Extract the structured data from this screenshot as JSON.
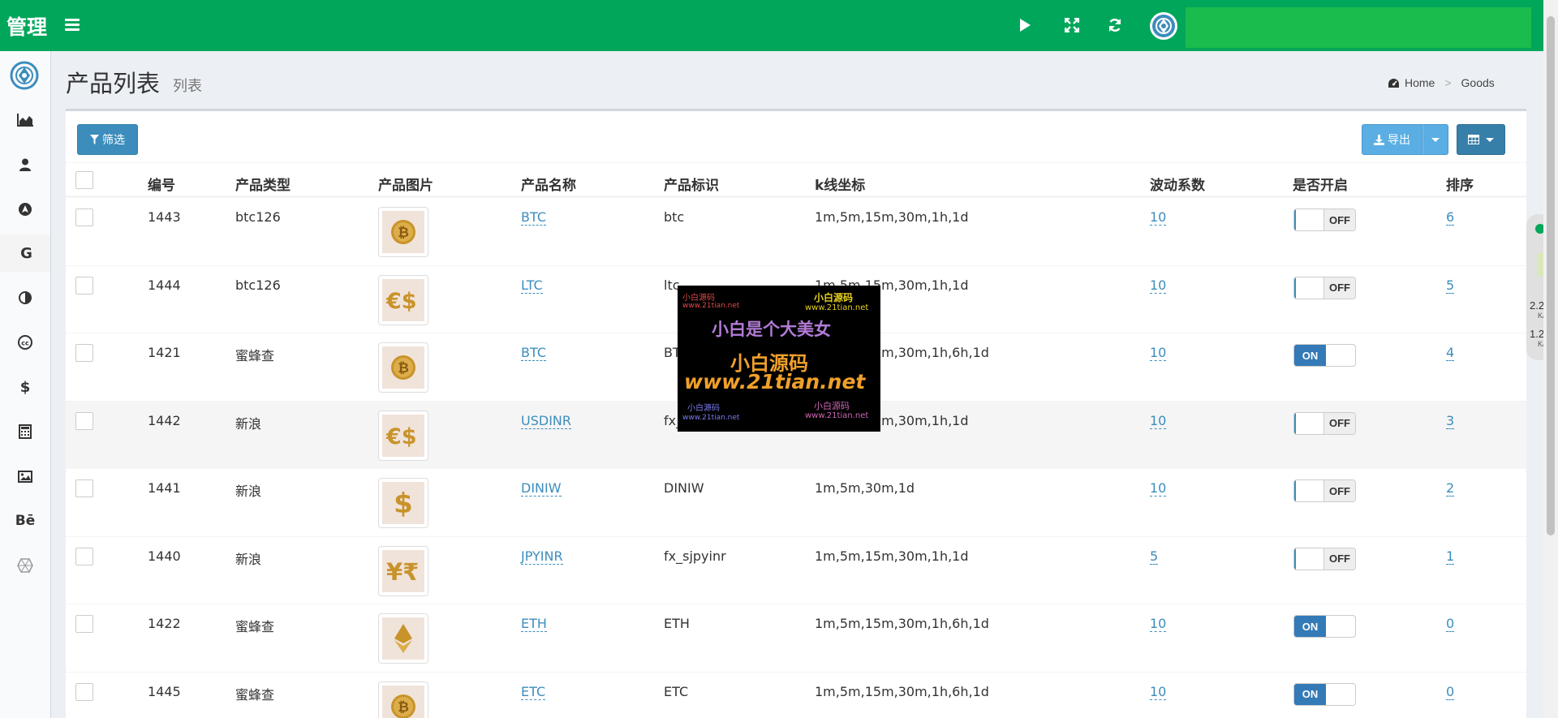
{
  "app": {
    "brand": "管理",
    "accent_color": "#00a65a"
  },
  "topbar": {
    "icons": [
      "menu-icon",
      "play-icon",
      "fullscreen-icon",
      "refresh-icon",
      "avatar-icon"
    ]
  },
  "sidebar": {
    "items": [
      {
        "icon": "area-chart-icon"
      },
      {
        "icon": "user-icon"
      },
      {
        "icon": "navigation-icon"
      },
      {
        "icon": "google-icon",
        "text": "G"
      },
      {
        "icon": "contrast-icon"
      },
      {
        "icon": "creative-commons-icon"
      },
      {
        "icon": "dollar-icon",
        "text": "$"
      },
      {
        "icon": "calculator-icon"
      },
      {
        "icon": "image-icon"
      },
      {
        "icon": "behance-icon",
        "text": "Bē"
      },
      {
        "icon": "hexagon-icon"
      }
    ]
  },
  "header": {
    "title": "产品列表",
    "subtitle": "列表",
    "breadcrumb": [
      "Home",
      "Goods"
    ]
  },
  "toolbar": {
    "filter_label": "筛选",
    "export_label": "导出"
  },
  "table": {
    "columns": [
      "编号",
      "产品类型",
      "产品图片",
      "产品名称",
      "产品标识",
      "k线坐标",
      "波动系数",
      "是否开启",
      "排序"
    ],
    "rows": [
      {
        "id": "1443",
        "type": "btc126",
        "image": "bitcoin-coin",
        "name": "BTC",
        "code": "btc",
        "kline": "1m,5m,15m,30m,1h,1d",
        "volatility": "10",
        "enabled": "OFF",
        "sort": "6"
      },
      {
        "id": "1444",
        "type": "btc126",
        "image": "euro-dollar",
        "name": "LTC",
        "code": "ltc",
        "kline": "1m,5m,15m,30m,1h,1d",
        "volatility": "10",
        "enabled": "OFF",
        "sort": "5"
      },
      {
        "id": "1421",
        "type": "蜜蜂查",
        "image": "bitcoin-coin",
        "name": "BTC",
        "code": "BTC",
        "kline": "1m,5m,15m,30m,1h,6h,1d",
        "volatility": "10",
        "enabled": "ON",
        "sort": "4"
      },
      {
        "id": "1442",
        "type": "新浪",
        "image": "euro-dollar",
        "name": "USDINR",
        "code": "fx_susdinr",
        "kline": "1m,5m,15m,30m,1h,1d",
        "volatility": "10",
        "enabled": "OFF",
        "sort": "3"
      },
      {
        "id": "1441",
        "type": "新浪",
        "image": "dollar",
        "name": "DINIW",
        "code": "DINIW",
        "kline": "1m,5m,30m,1d",
        "volatility": "10",
        "enabled": "OFF",
        "sort": "2"
      },
      {
        "id": "1440",
        "type": "新浪",
        "image": "yen-rupee",
        "name": "JPYINR",
        "code": "fx_sjpyinr",
        "kline": "1m,5m,15m,30m,1h,1d",
        "volatility": "5",
        "enabled": "OFF",
        "sort": "1"
      },
      {
        "id": "1422",
        "type": "蜜蜂查",
        "image": "ethereum",
        "name": "ETH",
        "code": "ETH",
        "kline": "1m,5m,15m,30m,1h,6h,1d",
        "volatility": "10",
        "enabled": "ON",
        "sort": "0"
      },
      {
        "id": "1445",
        "type": "蜜蜂查",
        "image": "bitcoin-coin",
        "name": "ETC",
        "code": "ETC",
        "kline": "1m,5m,15m,30m,1h,6h,1d",
        "volatility": "10",
        "enabled": "ON",
        "sort": "0"
      }
    ]
  },
  "watermark": {
    "line1": "小白是个大美女",
    "line2": "小白源码",
    "line3": "www.21tian.net",
    "small_a": "小白源码",
    "small_b": "www.21tian.net"
  },
  "speed_widget": {
    "up": "2.2",
    "up_unit": "K/s",
    "down": "1.2",
    "down_unit": "K/s"
  }
}
